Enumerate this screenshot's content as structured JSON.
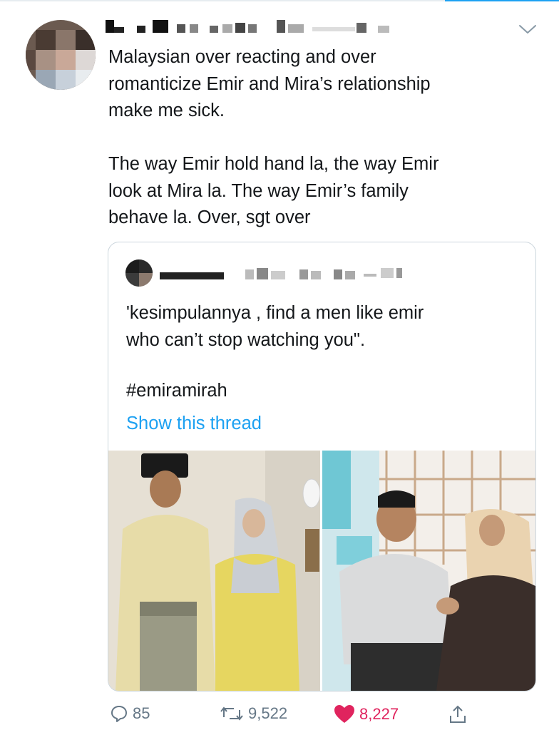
{
  "tweet": {
    "author_avatar_icon": "avatar-pixelated",
    "author_name_obscured": true,
    "menu_icon": "chevron-down-icon",
    "text": "Malaysian over reacting and over\nromanticize Emir and Mira’s relationship\nmake me sick.\n\nThe way Emir hold hand la, the way Emir\nlook at Mira la. The way Emir’s family\nbehave la. Over, sgt over"
  },
  "quoted_tweet": {
    "author_avatar_icon": "avatar-pixelated",
    "author_name_obscured": true,
    "text": "'kesimpulannya , find a men like emir\nwho can’t stop watching you\".",
    "hashtag": "#emiramirah",
    "show_thread": "Show this thread",
    "media": {
      "left_photo_icon": "couple-standing-photo",
      "right_photo_icon": "couple-seated-photo"
    }
  },
  "actions": {
    "reply_count": "85",
    "retweet_count": "9,522",
    "like_count": "8,227",
    "reply_icon": "reply-icon",
    "retweet_icon": "retweet-icon",
    "like_icon": "heart-icon",
    "share_icon": "share-icon"
  },
  "colors": {
    "accent": "#1da1f2",
    "like": "#e0245e",
    "muted": "#657786",
    "text": "#14171a",
    "border": "#ccd6dd"
  }
}
